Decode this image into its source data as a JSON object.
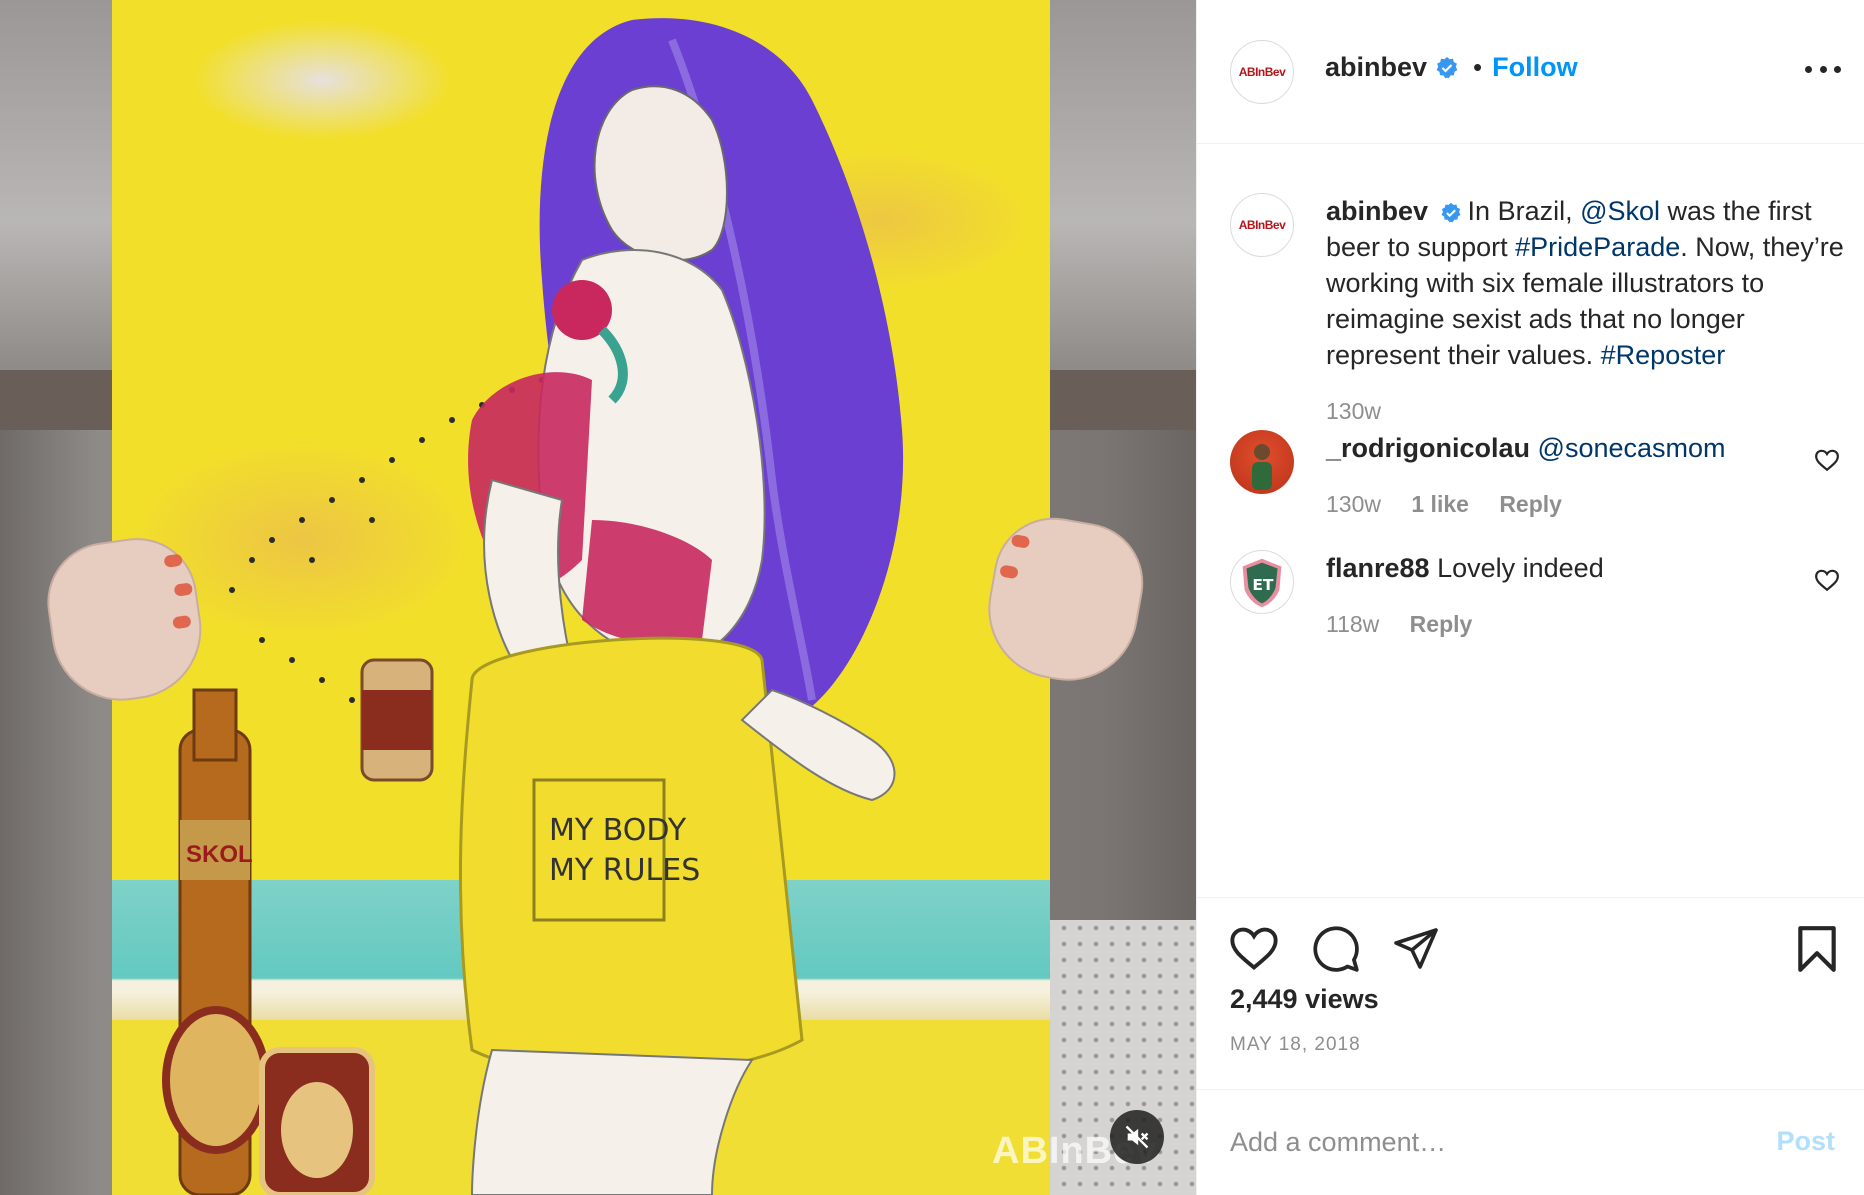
{
  "post": {
    "username": "abinbev",
    "follow_label": "Follow",
    "separator": "•",
    "brand_avatar_text": "ABInBev"
  },
  "media": {
    "watermark": "ABInBev",
    "mute_icon": "speaker-muted-icon",
    "poster_text_line1": "MY BODY",
    "poster_text_line2": "MY RULES",
    "bottle_label": "SKOL"
  },
  "caption": {
    "username": "abinbev",
    "text_part1": "In Brazil, ",
    "mention": "@Skol",
    "text_part2": " was the first beer to support ",
    "hashtag1": "#PrideParade",
    "text_part3": ". Now, they’re working with six female illustrators to reimagine sexist ads that no longer represent their values. ",
    "hashtag2": "#Reposter",
    "time": "130w"
  },
  "comments": [
    {
      "username": "_rodrigonicolau",
      "mention": "@sonecasmom",
      "text": "",
      "time": "130w",
      "likes": "1 like",
      "reply": "Reply"
    },
    {
      "username": "flanre88",
      "mention": "",
      "text": "Lovely indeed",
      "time": "118w",
      "likes": "",
      "reply": "Reply"
    }
  ],
  "actions": {
    "views": "2,449 views",
    "date": "MAY 18, 2018",
    "icons": [
      "heart-icon",
      "comment-icon",
      "share-icon",
      "bookmark-icon"
    ]
  },
  "add_comment": {
    "placeholder": "Add a comment…",
    "post_label": "Post"
  },
  "colors": {
    "accent_blue": "#0095f6",
    "link_dark_blue": "#00376b",
    "muted_gray": "#8e8e8e",
    "post_disabled": "#b2dffc",
    "poster_yellow": "#f2df2a",
    "hair_purple": "#6a3fd1"
  }
}
